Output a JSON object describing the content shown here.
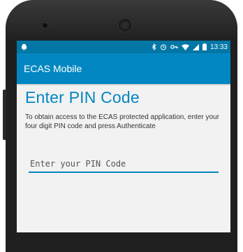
{
  "status_bar": {
    "time": "13:33",
    "icons": [
      "android-icon",
      "bluetooth-icon",
      "alarm-icon",
      "key-icon",
      "wifi-icon",
      "signal-icon",
      "battery-icon"
    ]
  },
  "app_bar": {
    "title": "ECAS Mobile"
  },
  "main": {
    "title": "Enter PIN Code",
    "instructions": "To obtain access to the ECAS protected application, enter your four digit PIN code and press Authenticate",
    "pin_input": {
      "placeholder": "Enter your PIN Code",
      "value": ""
    }
  },
  "colors": {
    "status_bar": "#0277a5",
    "app_bar": "#0387c2",
    "accent": "#0387c2",
    "screen_bg": "#f2f2f2"
  }
}
